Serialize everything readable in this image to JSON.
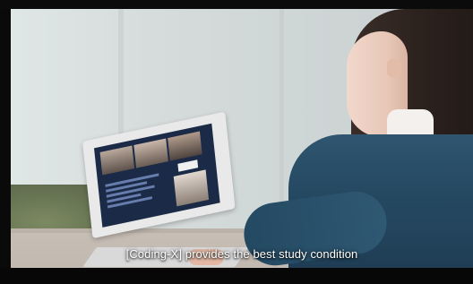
{
  "video": {
    "subtitle": "[Coding-X] provides the best study condition"
  },
  "scene": {
    "colors": {
      "wall": "#dfe6e6",
      "sweater": "#2f5570",
      "screen": "#1b2a46"
    }
  }
}
